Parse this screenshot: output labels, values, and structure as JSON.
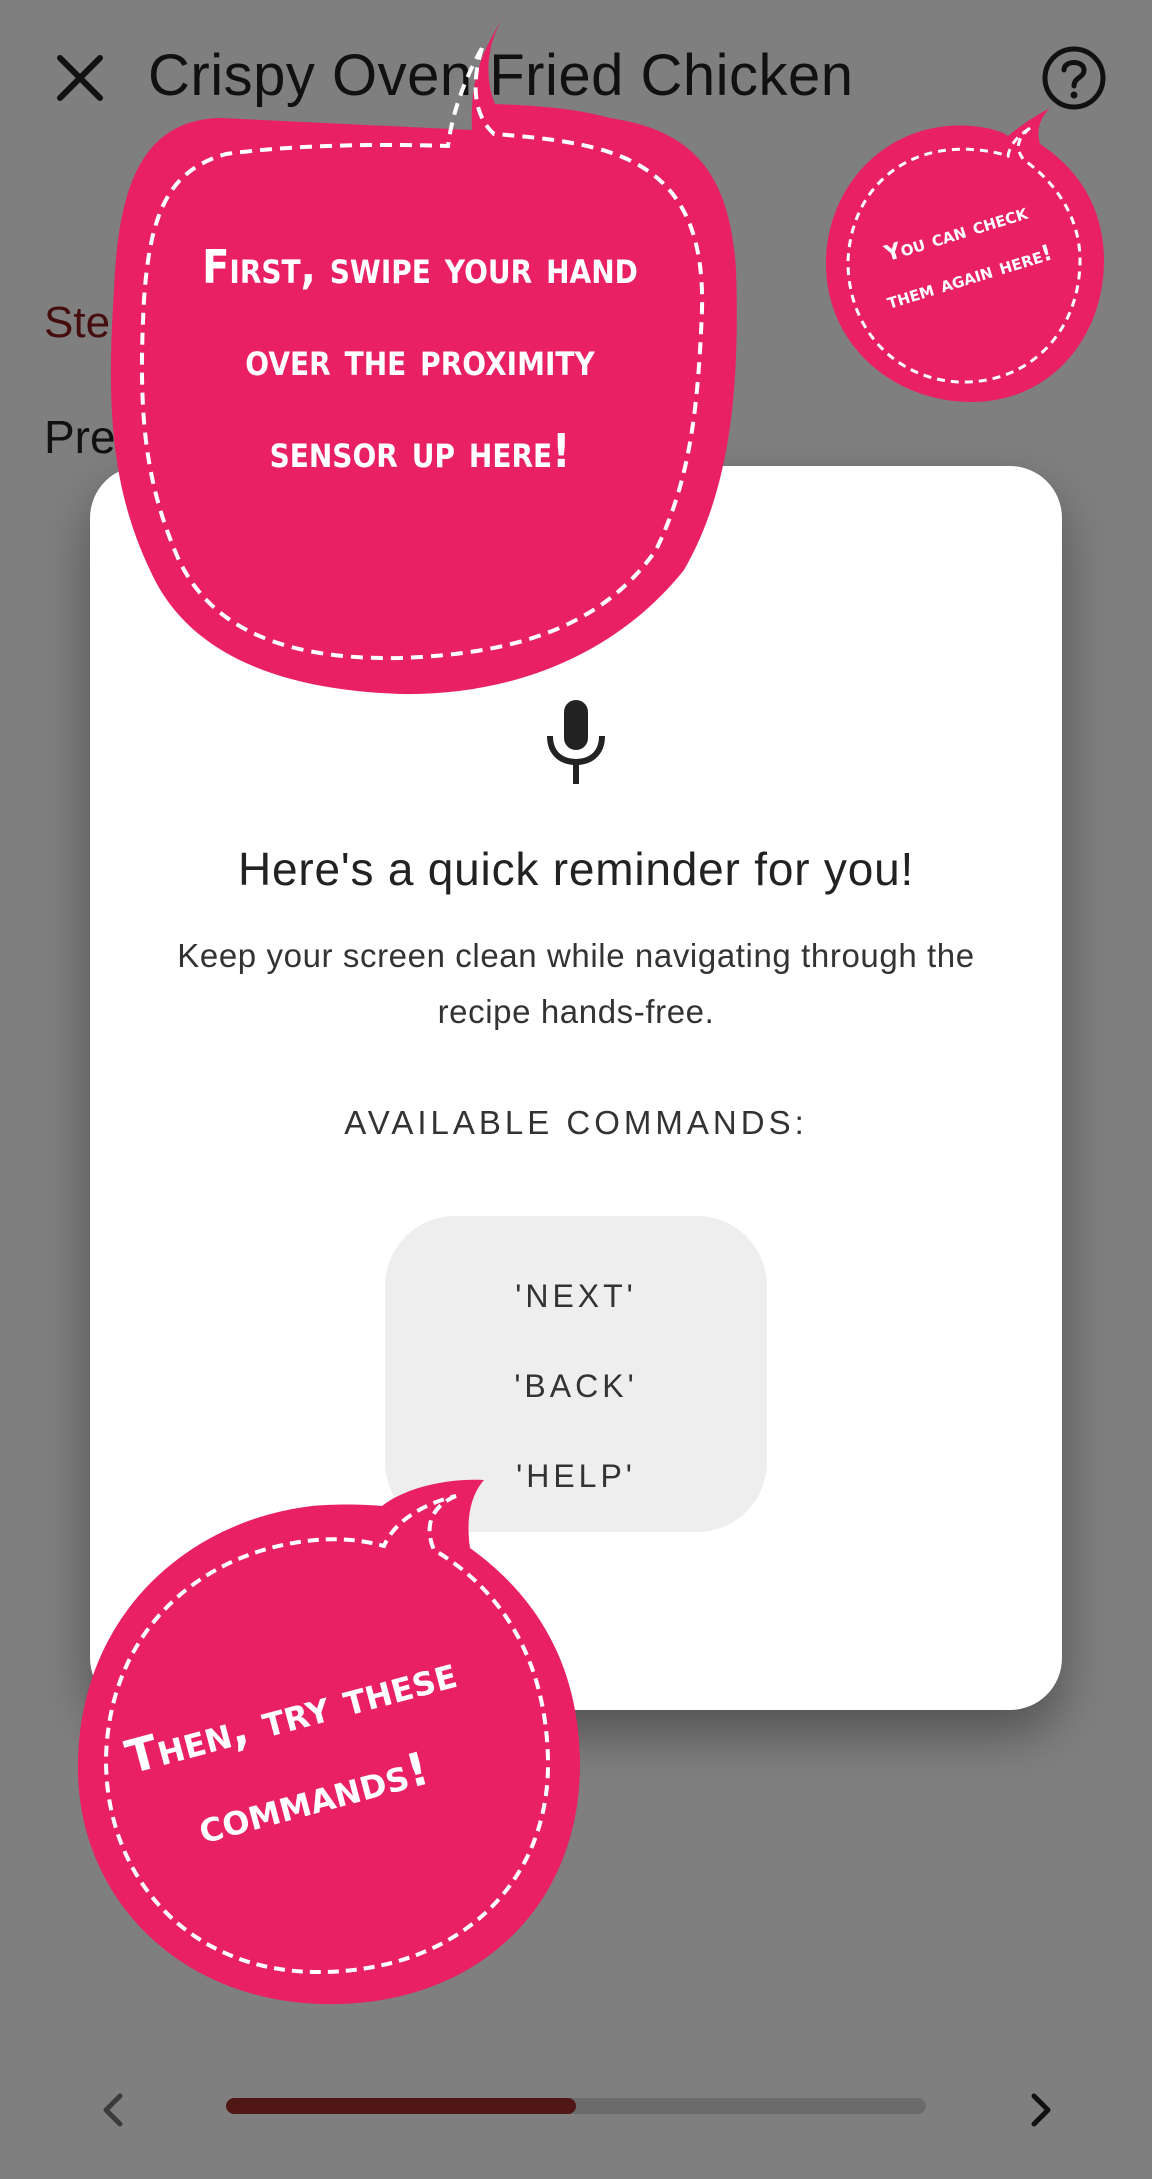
{
  "header": {
    "title": "Crispy Oven Fried Chicken",
    "close_icon": "close-icon",
    "help_icon": "help-circle-icon"
  },
  "content": {
    "step_label": "Ste",
    "step_text": "Pre"
  },
  "dialog": {
    "icon": "microphone-icon",
    "title": "Here's a quick reminder for you!",
    "body": "Keep your screen clean while navigating through the recipe hands-free.",
    "commands_heading": "AVAILABLE COMMANDS:",
    "commands": [
      "'NEXT'",
      "'BACK'",
      "'HELP'"
    ]
  },
  "tooltips": {
    "proximity_line1": "First, swipe your hand",
    "proximity_line2": "over the proximity",
    "proximity_line3": "sensor up here!",
    "help_line1": "You can check",
    "help_line2": "them again here!",
    "commands_line1": "Then, try these",
    "commands_line2": "commands!"
  },
  "navigation": {
    "prev_icon": "chevron-left-icon",
    "next_icon": "chevron-right-icon",
    "progress_percent": 50
  },
  "colors": {
    "bubble": "#ea2064",
    "progress": "#a32e2e",
    "step_label": "#8a1b1b"
  }
}
